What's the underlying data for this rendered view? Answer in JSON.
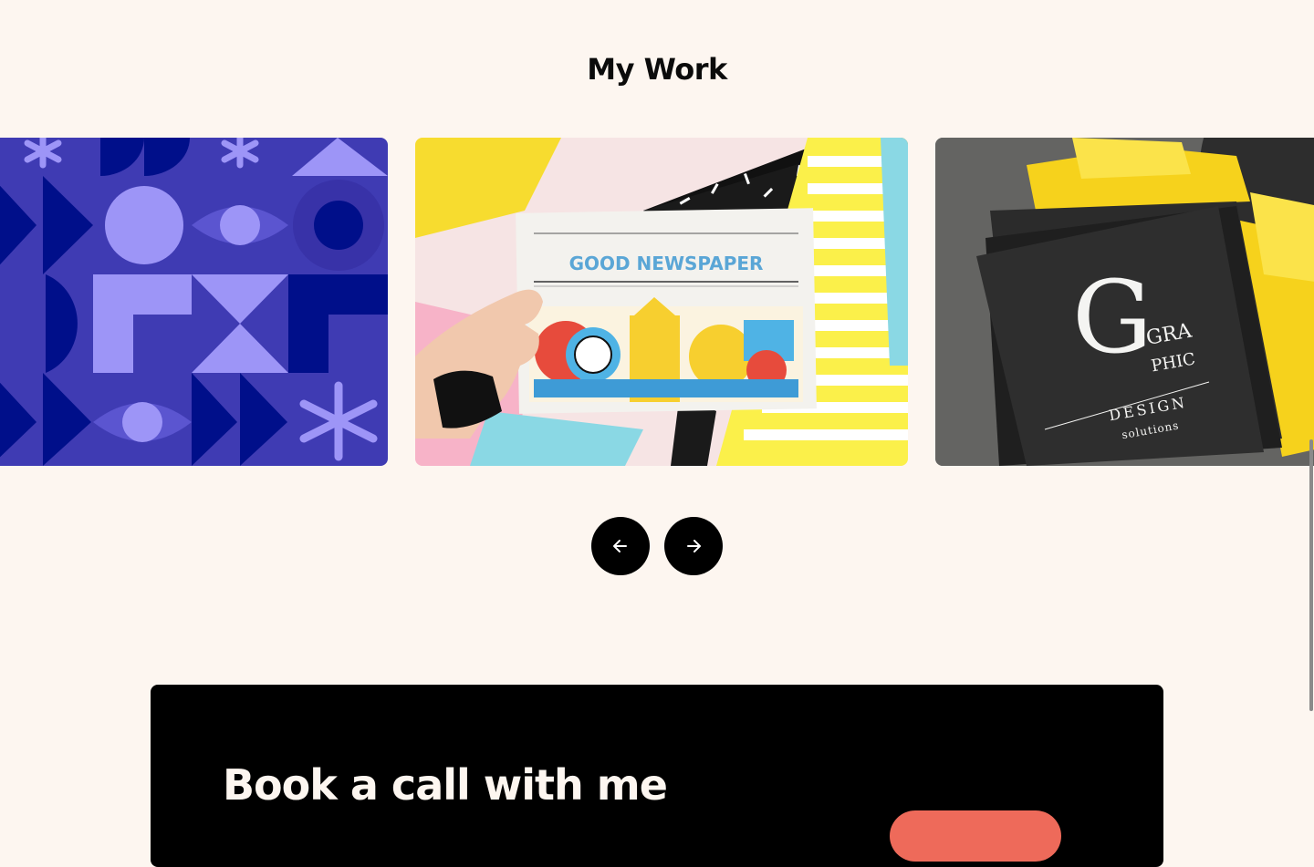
{
  "work": {
    "title": "My Work",
    "slides": [
      {
        "name": "geometric-pattern",
        "colors": {
          "bg": "#3f3bb3",
          "dark": "#000f8a",
          "light": "#9d95f7"
        }
      },
      {
        "name": "good-newspaper",
        "masthead": "GOOD NEWSPAPER"
      },
      {
        "name": "graphic-design-book",
        "cover": {
          "line1": "GRA",
          "line2": "PHIC",
          "line3": "DESIGN",
          "line4": "solutions"
        }
      }
    ],
    "controls": {
      "prev_icon": "arrow-left-icon",
      "next_icon": "arrow-right-icon"
    }
  },
  "cta": {
    "title": "Book a call with me",
    "accent": "#ee6a5a"
  },
  "theme": {
    "background": "#fdf6f0",
    "text": "#0b0b0b",
    "button": "#000000"
  }
}
